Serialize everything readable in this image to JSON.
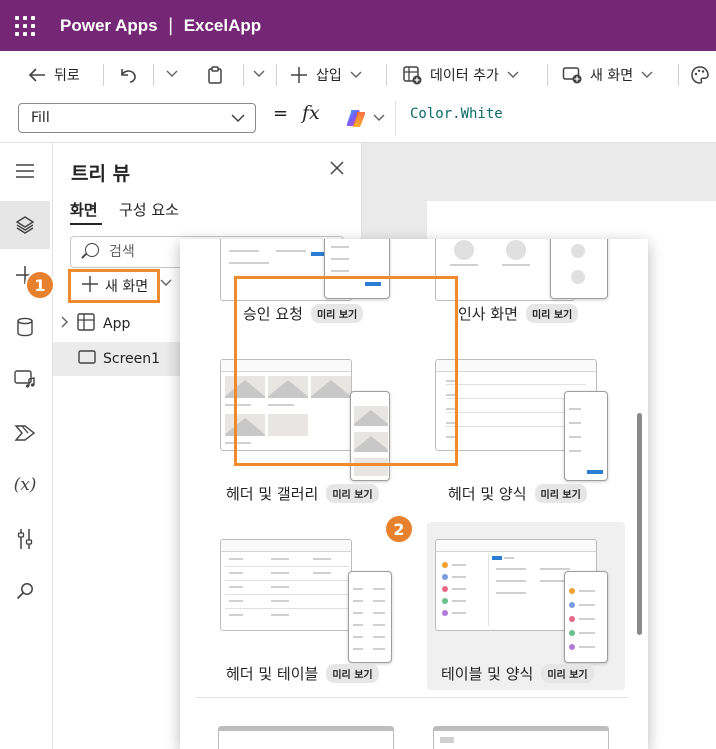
{
  "topbar": {
    "app_name": "Power Apps",
    "separator": "|",
    "file_name": "ExcelApp"
  },
  "commands": {
    "back": "뒤로",
    "insert": "삽입",
    "add_data": "데이터 추가",
    "new_screen": "새 화면"
  },
  "formula_bar": {
    "property": "Fill",
    "equals": "=",
    "fx": "fx",
    "formula": "Color.White"
  },
  "tree_view": {
    "title": "트리 뷰",
    "tabs": [
      "화면",
      "구성 요소"
    ],
    "search_placeholder": "검색",
    "new_screen_button": "새 화면",
    "items": [
      "App",
      "Screen1"
    ]
  },
  "callouts": [
    "1",
    "2"
  ],
  "templates": [
    {
      "name": "승인 요청",
      "preview": "미리 보기"
    },
    {
      "name": "인사 화면",
      "preview": "미리 보기"
    },
    {
      "name": "헤더 및 갤러리",
      "preview": "미리 보기"
    },
    {
      "name": "헤더 및 양식",
      "preview": "미리 보기"
    },
    {
      "name": "헤더 및 테이블",
      "preview": "미리 보기"
    },
    {
      "name": "테이블 및 양식",
      "preview": "미리 보기",
      "selected": true
    }
  ],
  "colors": {
    "topbar": "#742774",
    "callout": "#e8812d",
    "highlight_border": "#f08a2c"
  }
}
